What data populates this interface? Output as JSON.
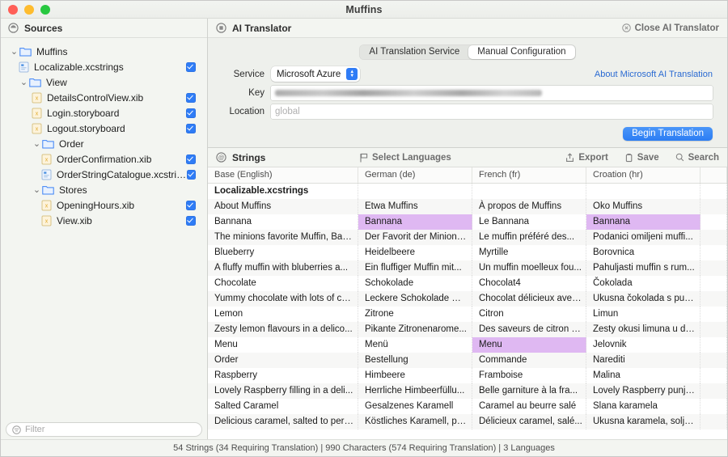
{
  "window": {
    "title": "Muffins",
    "traffic_lights": [
      "close-red",
      "minimize-yellow",
      "zoom-green"
    ]
  },
  "sidebar": {
    "header": {
      "label": "Sources",
      "icon": "sources-icon"
    },
    "tree": [
      {
        "label": "Muffins",
        "type": "folder",
        "level": 0,
        "expanded": true,
        "checkbox": null
      },
      {
        "label": "Localizable.xcstrings",
        "type": "strings",
        "level": 1,
        "expanded": null,
        "checkbox": true
      },
      {
        "label": "View",
        "type": "folder",
        "level": 1,
        "expanded": true,
        "checkbox": null
      },
      {
        "label": "DetailsControlView.xib",
        "type": "xib",
        "level": 2,
        "expanded": null,
        "checkbox": true
      },
      {
        "label": "Login.storyboard",
        "type": "xib",
        "level": 2,
        "expanded": null,
        "checkbox": true
      },
      {
        "label": "Logout.storyboard",
        "type": "xib",
        "level": 2,
        "expanded": null,
        "checkbox": true
      },
      {
        "label": "Order",
        "type": "folder",
        "level": 2,
        "expanded": true,
        "checkbox": null
      },
      {
        "label": "OrderConfirmation.xib",
        "type": "xib",
        "level": 3,
        "expanded": null,
        "checkbox": true
      },
      {
        "label": "OrderStringCatalogue.xcstrings",
        "type": "strings",
        "level": 3,
        "expanded": null,
        "checkbox": true
      },
      {
        "label": "Stores",
        "type": "folder",
        "level": 2,
        "expanded": true,
        "checkbox": null
      },
      {
        "label": "OpeningHours.xib",
        "type": "xib",
        "level": 3,
        "expanded": null,
        "checkbox": true
      },
      {
        "label": "View.xib",
        "type": "xib",
        "level": 3,
        "expanded": null,
        "checkbox": true
      }
    ],
    "filter": {
      "placeholder": "Filter",
      "value": "",
      "icon": "filter-icon"
    }
  },
  "ai_translator": {
    "title": "AI Translator",
    "title_icon": "ai-translator-icon",
    "close_label": "Close AI Translator",
    "close_icon": "close-circle-icon",
    "tabs": [
      {
        "label": "AI Translation Service",
        "active": false
      },
      {
        "label": "Manual Configuration",
        "active": true
      }
    ],
    "form": {
      "service_label": "Service",
      "service_value": "Microsoft Azure",
      "service_options": [
        "Microsoft Azure"
      ],
      "key_label": "Key",
      "key_value": "",
      "key_redacted": true,
      "location_label": "Location",
      "location_value": "",
      "location_placeholder": "global",
      "about_link": "About Microsoft AI Translation",
      "begin_button": "Begin Translation"
    }
  },
  "strings_toolbar": {
    "title": "Strings",
    "title_icon": "at-circle-icon",
    "select_languages": "Select Languages",
    "select_languages_icon": "flag-icon",
    "actions": [
      {
        "label": "Export",
        "icon": "export-icon"
      },
      {
        "label": "Save",
        "icon": "save-icon"
      },
      {
        "label": "Search",
        "icon": "search-icon"
      }
    ]
  },
  "table": {
    "columns": [
      "Base (English)",
      "German (de)",
      "French (fr)",
      "Croation (hr)",
      ""
    ],
    "group_header": "Localizable.xcstrings",
    "rows": [
      {
        "base": "About Muffins",
        "de": "Etwa Muffins",
        "fr": "À propos de Muffins",
        "hr": "Oko Muffins",
        "hl": []
      },
      {
        "base": "Bannana",
        "de": "Bannana",
        "fr": "Le Bannana",
        "hr": "Bannana",
        "hl": [
          "de",
          "hr"
        ]
      },
      {
        "base": "The minions favorite Muffin, Ban...",
        "de": "Der Favorit der Minions...",
        "fr": "Le muffin préféré des...",
        "hr": "Podanici omiljeni muffi...",
        "hl": []
      },
      {
        "base": "Blueberry",
        "de": "Heidelbeere",
        "fr": "Myrtille",
        "hr": "Borovnica",
        "hl": []
      },
      {
        "base": "A fluffy muffin with bluberries a...",
        "de": "Ein fluffiger Muffin mit...",
        "fr": "Un muffin moelleux fou...",
        "hr": "Pahuljasti muffin s rum...",
        "hl": []
      },
      {
        "base": "Chocolate",
        "de": "Schokolade",
        "fr": "Chocolat4",
        "hr": "Čokolada",
        "hl": []
      },
      {
        "base": "Yummy chocolate with lots of ch...",
        "de": "Leckere Schokolade mi...",
        "fr": "Chocolat délicieux avec...",
        "hr": "Ukusna čokolada s pun...",
        "hl": []
      },
      {
        "base": "Lemon",
        "de": "Zitrone",
        "fr": "Citron",
        "hr": "Limun",
        "hl": []
      },
      {
        "base": "Zesty lemon flavours in a delico...",
        "de": "Pikante Zitronenarome...",
        "fr": "Des saveurs de citron p...",
        "hr": "Zesty okusi limuna u de...",
        "hl": []
      },
      {
        "base": "Menu",
        "de": "Menü",
        "fr": "Menu",
        "hr": "Jelovnik",
        "hl": [
          "fr"
        ]
      },
      {
        "base": "Order",
        "de": "Bestellung",
        "fr": "Commande",
        "hr": "Narediti",
        "hl": []
      },
      {
        "base": "Raspberry",
        "de": "Himbeere",
        "fr": "Framboise",
        "hr": "Malina",
        "hl": []
      },
      {
        "base": "Lovely Raspberry filling in a deli...",
        "de": "Herrliche Himbeerfüllu...",
        "fr": "Belle garniture à la fra...",
        "hr": "Lovely Raspberry punje...",
        "hl": []
      },
      {
        "base": "Salted Caramel",
        "de": "Gesalzenes Karamell",
        "fr": "Caramel au beurre salé",
        "hr": "Slana karamela",
        "hl": []
      },
      {
        "base": "Delicious caramel, salted to perf...",
        "de": "Köstliches Karamell, pe...",
        "fr": "Délicieux caramel, salé...",
        "hr": "Ukusna karamela, solje...",
        "hl": []
      }
    ]
  },
  "status": {
    "text": "54 Strings (34 Requiring Translation) | 990 Characters (574 Requiring Translation) | 3 Languages"
  },
  "colors": {
    "accent_blue": "#2f7cf6",
    "highlight_purple": "#dfb8f2",
    "link_blue": "#2a6ad2",
    "chrome_gray": "#f3f5f1"
  }
}
